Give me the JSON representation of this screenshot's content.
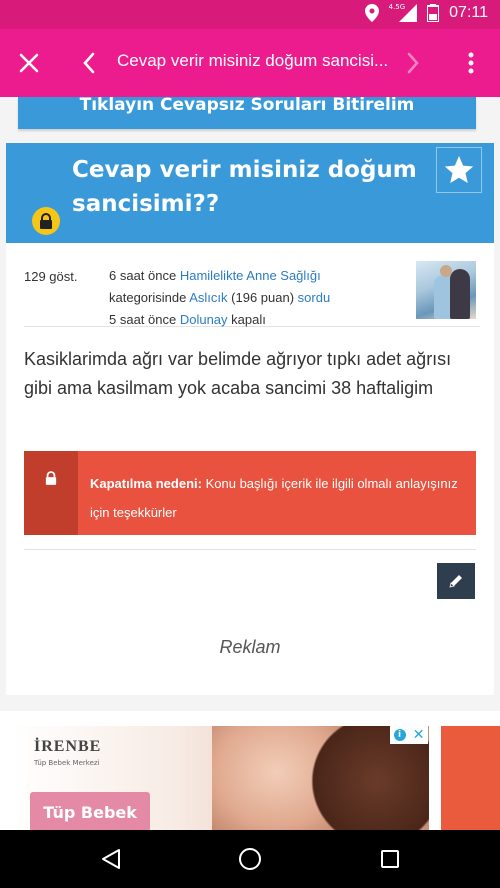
{
  "status_bar": {
    "network": "4.5G",
    "time": "07:11"
  },
  "toolbar": {
    "title": "Cevap verir misiniz doğum sancisi..."
  },
  "banner": {
    "text": "Tıklayın Cevapsız Soruları Bitirelim"
  },
  "question": {
    "title": "Cevap verir misiniz doğum sancisimi??",
    "views": "129 göst.",
    "meta": {
      "asked_time": "6 saat önce",
      "category_link": "Hamilelikte Anne Sağlığı",
      "category_suffix": "kategorisinde",
      "user_link": "Aslıcık",
      "points": "(196 puan)",
      "asked_link": "sordu",
      "closed_time": "5 saat önce",
      "closer_link": "Dolunay",
      "closed_word": "kapalı"
    },
    "body": "Kasiklarimda ağrı var belimde ağrıyor tıpkı adet ağrısı gibi ama kasilmam yok acaba sancimi 38 haftaligim",
    "closed_label": "Kapatılma nedeni:",
    "closed_reason": "Konu başlığı içerik ile ilgili olmalı anlayışınız için teşekkürler"
  },
  "ad": {
    "label": "Reklam",
    "brand": "İRENBE",
    "brand_sub": "Tüp Bebek Merkezi",
    "cta": "Tüp Bebek",
    "info_glyph": "i",
    "close_glyph": "✕"
  },
  "colors": {
    "status_bar": "#d81b7a",
    "toolbar": "#ec1c8e",
    "banner": "#3a9ad9",
    "lock": "#f5c518",
    "closed_box": "#e8523f",
    "link": "#2b7cc4",
    "edit_button": "#2f3e4e"
  },
  "icons": {
    "close": "close-icon",
    "back": "chevron-left-icon",
    "forward": "chevron-right-icon",
    "menu": "more-vert-icon",
    "lock": "lock-icon",
    "favorite": "star-icon",
    "edit": "pencil-icon"
  }
}
